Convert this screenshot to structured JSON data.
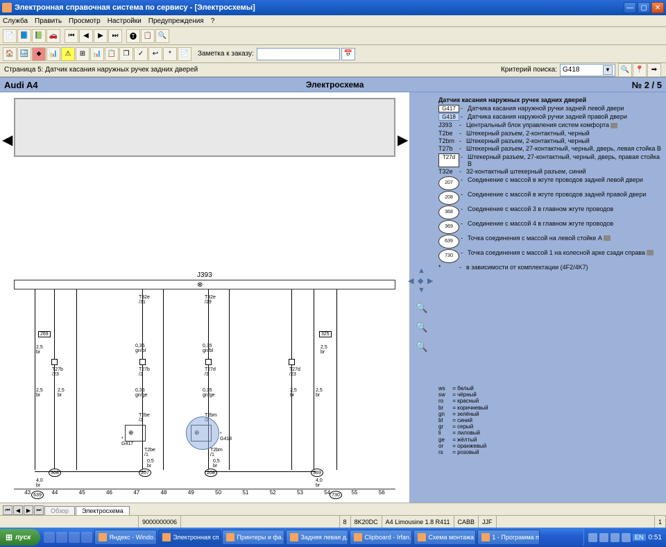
{
  "window": {
    "title": "Электронная справочная система по сервису - [Электросхемы]"
  },
  "menubar": {
    "items": [
      "Служба",
      "Править",
      "Просмотр",
      "Настройки",
      "Предупреждения",
      "?"
    ]
  },
  "toolbar2": {
    "note_label": "Заметка к заказу:"
  },
  "pageinfo": {
    "label": "Страница 5: Датчик касания наружных ручек задних дверей",
    "crit_label": "Критерий поиска:",
    "crit_value": "G418"
  },
  "header": {
    "model": "Audi A4",
    "mid": "Электросхема",
    "pageno": "№  2 / 5"
  },
  "diagram": {
    "j_label": "J393",
    "ruler": [
      "43",
      "44",
      "45",
      "46",
      "47",
      "48",
      "49",
      "50",
      "51",
      "52",
      "53",
      "54",
      "55",
      "56"
    ]
  },
  "legend": {
    "title": "Датчик касания наружных ручек задних дверей",
    "rows": [
      {
        "sym": "G417",
        "box": true,
        "txt": "Датчика касания наружной ручки задней левой двери"
      },
      {
        "sym": "G418",
        "box": true,
        "hl": true,
        "txt": "Датчика касания наружной ручки задней правой двери"
      },
      {
        "sym": "J393",
        "txt": "Центральный блок управления систем комфорта",
        "cam": true
      },
      {
        "sym": "T2be",
        "txt": "Штекерный разъем, 2-контактный, черный"
      },
      {
        "sym": "T2bm",
        "txt": "Штекерный разъем, 2-контактный, черный"
      },
      {
        "sym": "T27b",
        "txt": "Штекерный разъем, 27-контактный, черный, дверь, левая стойка B"
      },
      {
        "sym": "T27d",
        "box": true,
        "txt": "Штекерный разъем, 27-контактный, черный, дверь, правая стойка B"
      },
      {
        "sym": "T32e",
        "txt": "32-контактный штекерный разъем, синий"
      },
      {
        "sym": "207",
        "circ": true,
        "txt": "Соединение с массой в жгуте проводов задней левой двери"
      },
      {
        "sym": "208",
        "circ": true,
        "txt": "Соединение с массой в жгуте проводов задней правой двери"
      },
      {
        "sym": "368",
        "circ": true,
        "txt": "Соединение с массой 3 в главном жгуте проводов"
      },
      {
        "sym": "369",
        "circ": true,
        "txt": "Соединение с массой 4 в главном жгуте проводов"
      },
      {
        "sym": "639",
        "circ": true,
        "txt": "Точка соединения с массой на левой стойке A",
        "cam": true
      },
      {
        "sym": "730",
        "circ": true,
        "txt": "Точка соединения с массой 1 на колесной арке сзади справа",
        "cam": true
      },
      {
        "sym": "*",
        "txt": "в зависимости от комплектации (4F2/4K7)"
      }
    ]
  },
  "colorleg": [
    {
      "k": "ws",
      "v": "белый"
    },
    {
      "k": "sw",
      "v": "чёрный"
    },
    {
      "k": "ro",
      "v": "красный"
    },
    {
      "k": "br",
      "v": "коричневый"
    },
    {
      "k": "gn",
      "v": "зелёный"
    },
    {
      "k": "bl",
      "v": "синий"
    },
    {
      "k": "gr",
      "v": "серый"
    },
    {
      "k": "li",
      "v": "лиловый"
    },
    {
      "k": "ge",
      "v": "жёлтый"
    },
    {
      "k": "or",
      "v": "оранжевый"
    },
    {
      "k": "rs",
      "v": "розовый"
    }
  ],
  "tabs": {
    "t1": "Обзор",
    "t2": "Электросхема"
  },
  "status": {
    "s1": "9000000006",
    "s2": "8",
    "s3": "8K20DC",
    "s4": "A4 Limousine 1.8 R411",
    "s5": "CABB",
    "s6": "JJF",
    "s7": "1"
  },
  "taskbar": {
    "start": "пуск",
    "items": [
      "Яндекс - Windo…",
      "Электронная сп…",
      "Принтеры и фа…",
      "Задняя левая д…",
      "Clipboard - Irfan…",
      "Схема монтажа …",
      "1 - Программа п…"
    ],
    "lang": "EN",
    "clock": "0:51"
  }
}
